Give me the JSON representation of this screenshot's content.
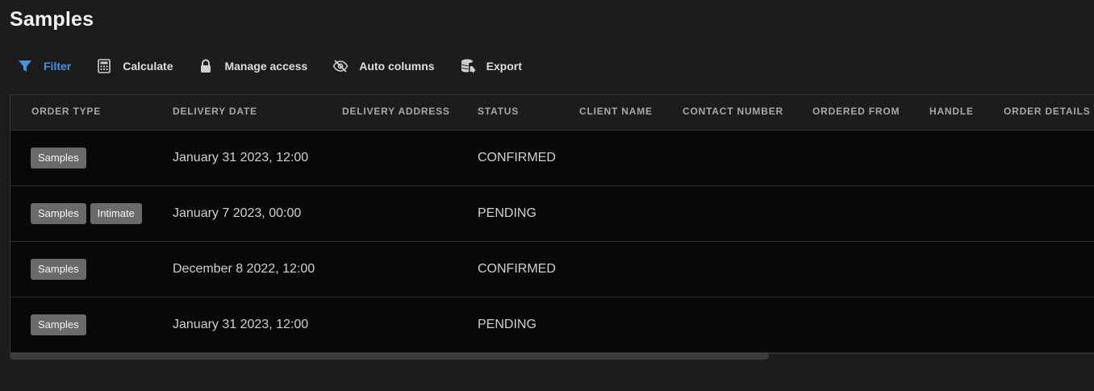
{
  "page": {
    "title": "Samples"
  },
  "toolbar": {
    "items": [
      {
        "label": "Filter",
        "icon": "filter-icon",
        "active": true
      },
      {
        "label": "Calculate",
        "icon": "calculator-icon"
      },
      {
        "label": "Manage access",
        "icon": "lock-icon"
      },
      {
        "label": "Auto columns",
        "icon": "eye-off-icon"
      },
      {
        "label": "Export",
        "icon": "database-export-icon"
      }
    ]
  },
  "colors": {
    "accent": "#4a8fe0",
    "background": "#1c1c1d",
    "grid_background": "#080808",
    "tag_background": "#6a6a6a"
  },
  "table": {
    "columns": [
      "ORDER TYPE",
      "DELIVERY DATE",
      "DELIVERY ADDRESS",
      "STATUS",
      "CLIENT NAME",
      "CONTACT NUMBER",
      "ORDERED FROM",
      "HANDLE",
      "ORDER DETAILS"
    ],
    "rows": [
      {
        "order_type": [
          "Samples"
        ],
        "delivery_date": "January 31 2023, 12:00",
        "delivery_address": "",
        "status": "CONFIRMED"
      },
      {
        "order_type": [
          "Samples",
          "Intimate"
        ],
        "delivery_date": "January 7 2023, 00:00",
        "delivery_address": "",
        "status": "PENDING"
      },
      {
        "order_type": [
          "Samples"
        ],
        "delivery_date": "December 8 2022, 12:00",
        "delivery_address": "",
        "status": "CONFIRMED"
      },
      {
        "order_type": [
          "Samples"
        ],
        "delivery_date": "January 31 2023, 12:00",
        "delivery_address": "",
        "status": "PENDING"
      }
    ]
  }
}
